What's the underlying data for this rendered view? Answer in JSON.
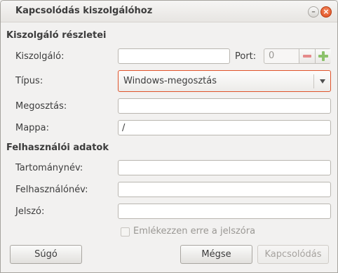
{
  "window": {
    "title": "Kapcsolódás kiszolgálóhoz",
    "minimize_glyph": "–",
    "close_glyph": "×"
  },
  "server_section": {
    "heading": "Kiszolgáló részletei",
    "server_label": "Kiszolgáló:",
    "server_value": "",
    "port_label": "Port:",
    "port_value": "0",
    "type_label": "Típus:",
    "type_value": "Windows-megosztás",
    "share_label": "Megosztás:",
    "share_value": "",
    "folder_label": "Mappa:",
    "folder_value": "/"
  },
  "user_section": {
    "heading": "Felhasználói adatok",
    "domain_label": "Tartománynév:",
    "domain_value": "",
    "username_label": "Felhasználónév:",
    "username_value": "",
    "password_label": "Jelszó:",
    "password_value": "",
    "remember_label": "Emlékezzen erre a jelszóra",
    "remember_checked": false
  },
  "buttons": {
    "help": "Súgó",
    "cancel": "Mégse",
    "connect": "Kapcsolódás"
  },
  "colors": {
    "accent_focus": "#e0532a",
    "close_button": "#df4a1b",
    "spin_minus": "#e58a8a",
    "spin_plus": "#8cc26b"
  },
  "icons": {
    "minimize": "minimize-icon",
    "close": "close-icon",
    "dropdown": "chevron-down-icon",
    "minus": "minus-icon",
    "plus": "plus-icon"
  }
}
